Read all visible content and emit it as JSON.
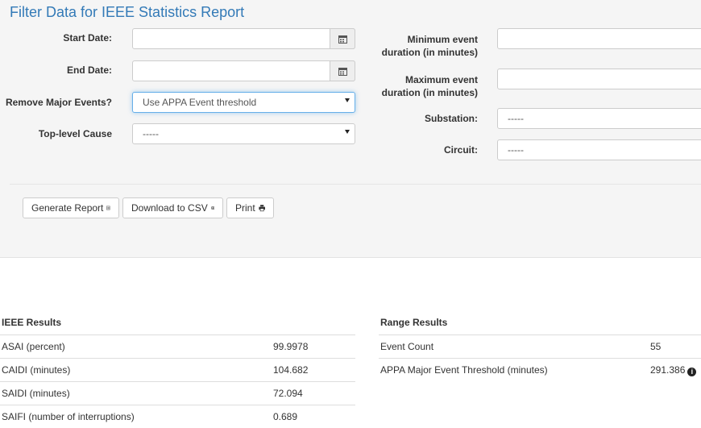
{
  "form": {
    "title": "Filter Data for IEEE Statistics Report",
    "start_date_label": "Start Date:",
    "start_date_value": "",
    "end_date_label": "End Date:",
    "end_date_value": "",
    "remove_major_label": "Remove Major Events?",
    "remove_major_value": "Use APPA Event threshold",
    "top_cause_label": "Top-level Cause",
    "top_cause_value": "-----",
    "min_duration_label_1": "Minimum event",
    "min_duration_label_2": "duration (in minutes)",
    "min_duration_value": "",
    "max_duration_label_1": "Maximum event",
    "max_duration_label_2": "duration (in minutes)",
    "max_duration_value": "",
    "substation_label": "Substation:",
    "substation_value": "-----",
    "circuit_label": "Circuit:",
    "circuit_value": "-----"
  },
  "actions": {
    "generate_label": "Generate Report",
    "csv_label": "Download to CSV",
    "print_label": "Print"
  },
  "ieee": {
    "title": "IEEE Results",
    "rows": [
      {
        "label": "ASAI (percent)",
        "value": "99.9978"
      },
      {
        "label": "CAIDI (minutes)",
        "value": "104.682"
      },
      {
        "label": "SAIDI (minutes)",
        "value": "72.094"
      },
      {
        "label": "SAIFI (number of interruptions)",
        "value": "0.689"
      }
    ]
  },
  "range": {
    "title": "Range Results",
    "rows": [
      {
        "label": "Event Count",
        "value": "55"
      },
      {
        "label": "APPA Major Event Threshold (minutes)",
        "value": "291.386"
      }
    ]
  }
}
